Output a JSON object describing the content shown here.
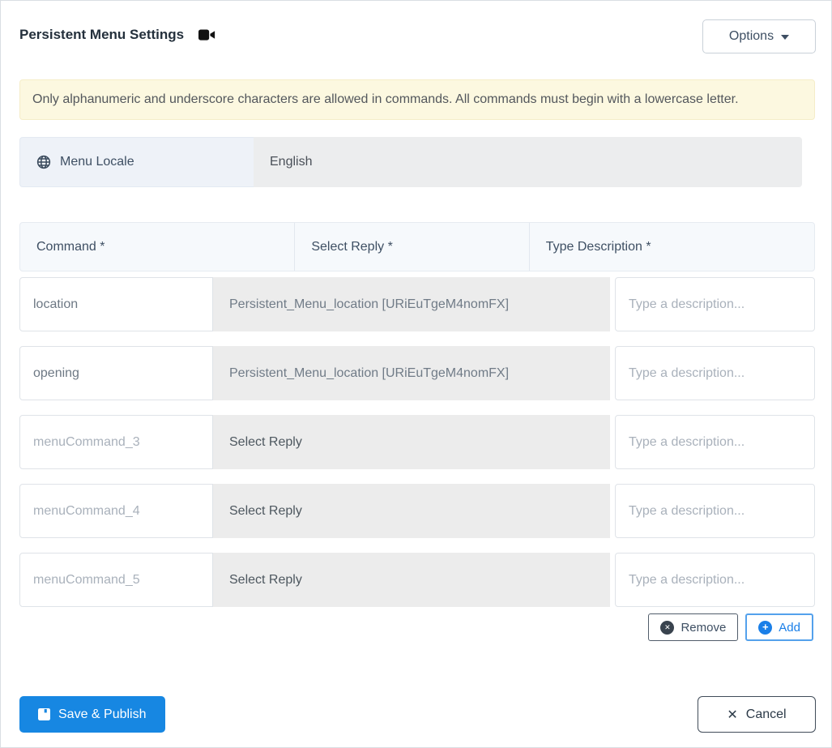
{
  "header": {
    "title": "Persistent Menu Settings",
    "options_button": "Options"
  },
  "banner": {
    "text": "Only alphanumeric and underscore characters are allowed in commands. All commands must begin with a lowercase letter."
  },
  "locale": {
    "label": "Menu Locale",
    "value": "English"
  },
  "table": {
    "headers": {
      "command": "Command *",
      "reply": "Select Reply *",
      "description": "Type Description *"
    },
    "rows": [
      {
        "command": "location",
        "reply": "Persistent_Menu_location [URiEuTgeM4nomFX]",
        "description_placeholder": "Type a description..."
      },
      {
        "command": "opening",
        "reply": "Persistent_Menu_location [URiEuTgeM4nomFX]",
        "description_placeholder": "Type a description..."
      },
      {
        "command_placeholder": "menuCommand_3",
        "reply": "Select Reply",
        "description_placeholder": "Type a description..."
      },
      {
        "command_placeholder": "menuCommand_4",
        "reply": "Select Reply",
        "description_placeholder": "Type a description..."
      },
      {
        "command_placeholder": "menuCommand_5",
        "reply": "Select Reply",
        "description_placeholder": "Type a description..."
      }
    ]
  },
  "row_actions": {
    "remove": "Remove",
    "add": "Add"
  },
  "footer": {
    "save": "Save & Publish",
    "cancel": "Cancel"
  },
  "colors": {
    "primary_blue": "#1787e2",
    "add_blue": "#1a7fe8",
    "banner_bg": "#fcf8e0",
    "dark_slate": "#3e4f63",
    "select_gray": "#ececec",
    "locale_label_bg": "#eef2f8",
    "table_header_bg": "#f6f9fc"
  }
}
